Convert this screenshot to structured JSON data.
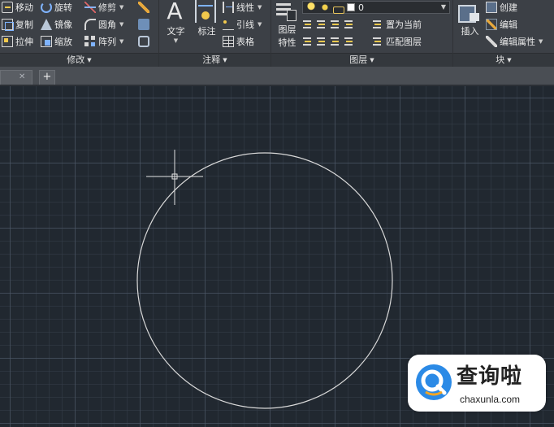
{
  "ribbon": {
    "modify": {
      "title": "修改",
      "move": "移动",
      "rotate": "旋转",
      "trim": "修剪",
      "copy": "复制",
      "mirror": "镜像",
      "fillet": "圆角",
      "stretch": "拉伸",
      "scale": "缩放",
      "array": "阵列"
    },
    "annotation": {
      "title": "注释",
      "text": "文字",
      "dimension": "标注",
      "linear": "线性",
      "leader": "引线",
      "table": "表格"
    },
    "layers": {
      "title": "图层",
      "layer_properties_line1": "图层",
      "layer_properties_line2": "特性",
      "current_layer": "0",
      "set_current": "置为当前",
      "match_layer": "匹配图层"
    },
    "block": {
      "title": "块",
      "insert": "插入",
      "create": "创建",
      "edit": "编辑",
      "edit_attributes": "编辑属性"
    }
  },
  "tabs": {
    "close_glyph": "✕",
    "new_glyph": "+"
  },
  "icons": {
    "modify": [
      "move-icon",
      "rotate-icon",
      "trim-icon",
      "copy-icon",
      "mirror-icon",
      "fillet-icon",
      "stretch-icon",
      "scale-icon",
      "array-icon"
    ],
    "accent_colors": {
      "yellow": "#f2c94c",
      "blue": "#7fb3ff"
    }
  },
  "canvas": {
    "background": "#212830",
    "circle_stroke": "#d9d9d9",
    "crosshair_color": "#e0e0e0"
  },
  "watermark": {
    "text_cn": "查询啦",
    "text_en": "chaxunla.com",
    "brand_blue": "#2b8ae6"
  }
}
